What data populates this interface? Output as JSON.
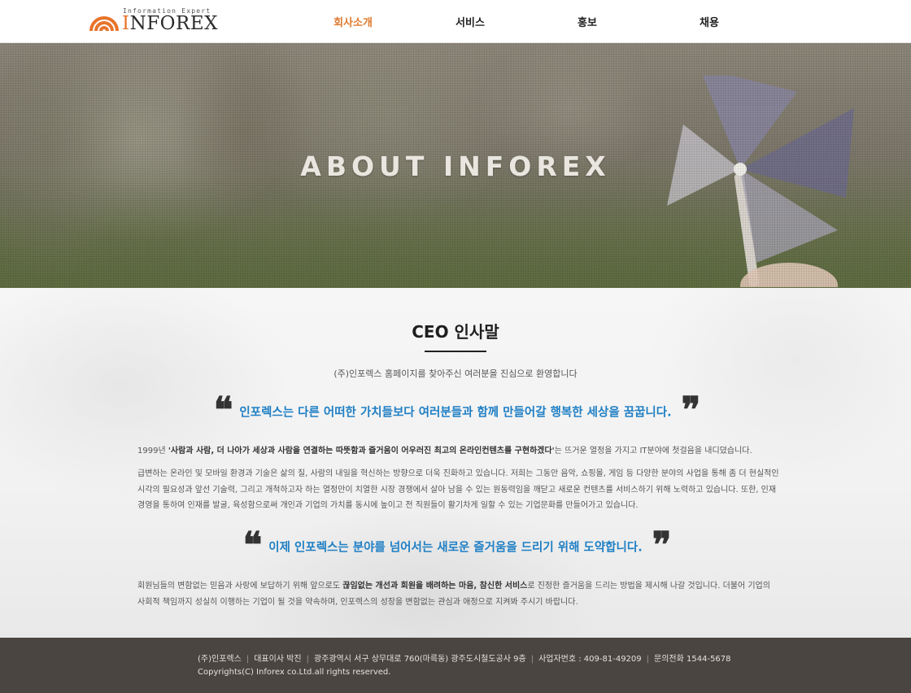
{
  "header": {
    "logo": {
      "tagline": "Information Expert",
      "wordmark_accent": "I",
      "wordmark_rest": "NFOREX"
    },
    "nav": [
      {
        "label": "회사소개",
        "active": true
      },
      {
        "label": "서비스",
        "active": false
      },
      {
        "label": "홍보",
        "active": false
      },
      {
        "label": "채용",
        "active": false
      }
    ]
  },
  "hero": {
    "title": "ABOUT INFOREX"
  },
  "content": {
    "title": "CEO 인사말",
    "subtitle": "(주)인포렉스 홈페이지를 찾아주신 여러분을 진심으로 환영합니다",
    "quote1": "인포렉스는 다른 어떠한 가치들보다 여러분들과 함께 만들어갈 행복한 세상을 꿈꿉니다.",
    "para1_a": "1999년 ",
    "para1_b": "'사람과 사람, 더 나아가 세상과 사람을 연결하는 따뜻함과 즐거움이 어우러진 최고의 온라인컨텐츠를 구현하겠다'",
    "para1_c": "는 뜨거운 열정을 가지고 IT분야에 첫걸음을 내디뎠습니다.",
    "para2": "급변하는 온라인 및 모바일 환경과 기술은 삶의 질, 사람의 내일을 혁신하는 방향으로 더욱 진화하고 있습니다. 저희는 그동안 음악, 쇼핑몰, 게임 등 다양한 분야의 사업을 통해 좀 더 현실적인 시각의 필요성과 앞선 기술력, 그리고 개척하고자 하는 열정만이 치열한 시장 경쟁에서 살아 남을 수 있는 원동력임을 깨닫고 새로운 컨텐츠를 서비스하기 위해 노력하고 있습니다. 또한, 인재경영을 통하여 인재를 발굴, 육성함으로써 개인과 기업의 가치를 동시에 높이고 전 직원들이 활기차게 일할 수 있는 기업문화를 만들어가고 있습니다.",
    "quote2": "이제 인포렉스는 분야를 넘어서는 새로운 즐거움을 드리기 위해 도약합니다.",
    "para3_a": "회원님들의 변함없는 믿음과 사랑에 보답하기 위해 앞으로도 ",
    "para3_b": "끊임없는 개선과 회원을 배려하는 마음, 참신한 서비스",
    "para3_c": "로 진정한 즐거움을 드리는 방법을 제시해 나갈 것입니다. 더불어 기업의 사회적 책임까지 성실히 이행하는 기업이 될 것을 약속하며, 인포렉스의 성장을 변함없는 관심과 애정으로 지켜봐 주시기 바랍니다."
  },
  "footer": {
    "company": "(주)인포렉스",
    "ceo": "대표이사 박진",
    "address": "광주광역시 서구 상무대로 760(마륵동) 광주도시철도공사 9층",
    "business_no": "사업자번호 : 409-81-49209",
    "phone": "문의전화 1544-5678",
    "copyright": "Copyrights(C) Inforex co.Ltd.all rights reserved."
  },
  "colors": {
    "nav_active": "#e07a2e",
    "quote": "#1f7fc4",
    "footer_bg": "#4a4541",
    "logo_orange": "#e8732a"
  }
}
